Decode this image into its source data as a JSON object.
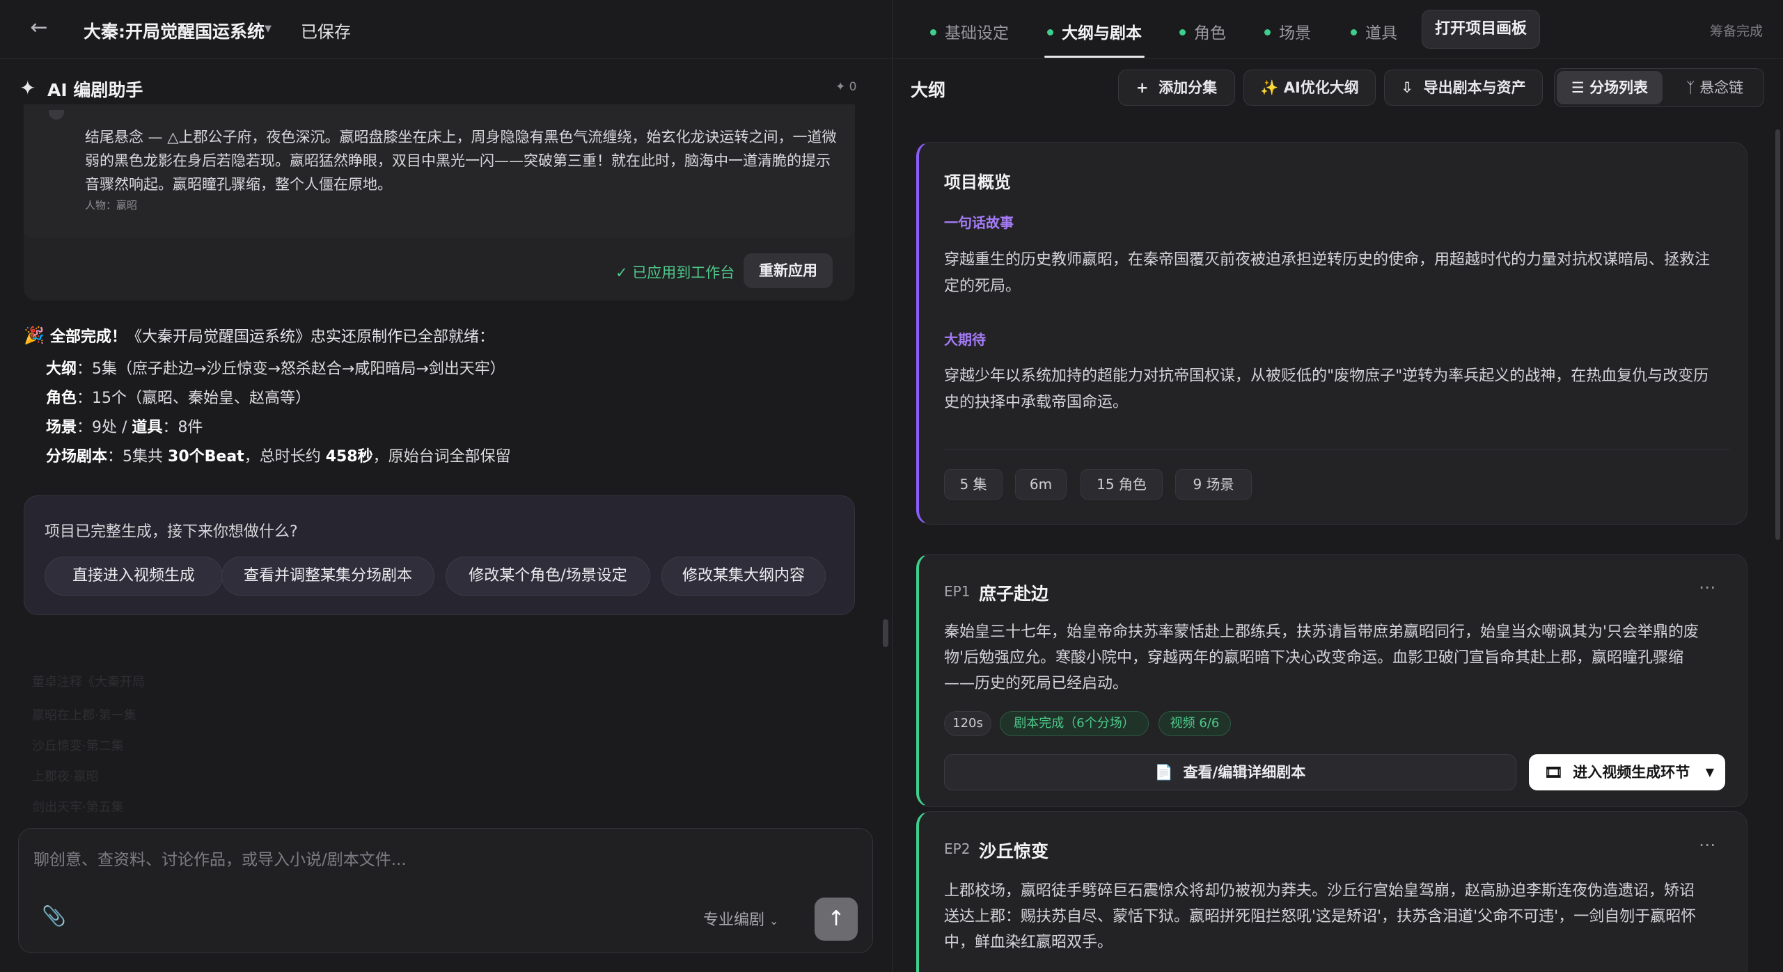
{
  "header": {
    "back_icon": "arrow-left-icon",
    "project_title": "大秦:开局觉醒国运系统",
    "save_status": "已保存"
  },
  "assistant": {
    "title": "AI 编剧助手",
    "count": "✦ 0",
    "prev_card": {
      "text": "结尾悬念 — △上郡公子府，夜色深沉。嬴昭盘膝坐在床上，周身隐隐有黑色气流缠绕，始玄化龙诀运转之间，一道微弱的黑色龙影在身后若隐若现。嬴昭猛然睁眼，双目中黑光一闪——突破第三重！就在此时，脑海中一道清脆的提示音骤然响起。嬴昭瞳孔骤缩，整个人僵在原地。",
      "people": "人物：嬴昭",
      "applied": "✓ 已应用到工作台",
      "reapply": "重新应用"
    },
    "done": {
      "icon": "🎉",
      "bold": "全部完成！",
      "rest": "《大秦开局觉醒国运系统》忠实还原制作已全部就绪：",
      "outline_label": "大纲",
      "outline_value": "：5集（庶子赴边→沙丘惊变→怒杀赵合→咸阳暗局→剑出天牢）",
      "roles_label": "角色",
      "roles_value": "：15个（嬴昭、秦始皇、赵高等）",
      "scenes_label": "场景",
      "scenes_value": "：9处 / ",
      "props_label": "道具",
      "props_value": "：8件",
      "script_label": "分场剧本",
      "script_a": "：5集共 ",
      "script_beats": "30个Beat",
      "script_b": "，总时长约 ",
      "script_secs": "458秒",
      "script_c": "，原始台词全部保留"
    },
    "next": {
      "question": "项目已完整生成，接下来你想做什么?",
      "options": [
        "直接进入视频生成",
        "查看并调整某集分场剧本",
        "修改某个角色/场景设定",
        "修改某集大纲内容"
      ]
    },
    "faded": [
      "董卓注释《大秦开局",
      "嬴昭在上郡·第一集",
      "沙丘惊变·第二集",
      "上郡夜·嬴昭",
      "剑出天牢·第五集"
    ],
    "composer": {
      "placeholder": "聊创意、查资料、讨论作品，或导入小说/剧本文件...",
      "mode": "专业编剧"
    }
  },
  "tabs": [
    {
      "label": "基础设定"
    },
    {
      "label": "大纲与剧本"
    },
    {
      "label": "角色"
    },
    {
      "label": "场景"
    },
    {
      "label": "道具"
    }
  ],
  "top_right": {
    "open_canvas": "打开项目画板",
    "prep_done": "筹备完成"
  },
  "outline": {
    "title": "大纲",
    "add_episode": "添加分集",
    "ai_optimize": "AI优化大纲",
    "export": "导出剧本与资产",
    "scene_list": "分场列表",
    "suspense_chain": "悬念链"
  },
  "overview": {
    "title": "项目概览",
    "logline_label": "一句话故事",
    "logline": "穿越重生的历史教师嬴昭，在秦帝国覆灭前夜被迫承担逆转历史的使命，用超越时代的力量对抗权谋暗局、拯救注定的死局。",
    "expect_label": "大期待",
    "expect": "穿越少年以系统加持的超能力对抗帝国权谋，从被贬低的\"废物庶子\"逆转为率兵起义的战神，在热血复仇与改变历史的抉择中承载帝国命运。",
    "chips": [
      "5 集",
      "6m",
      "15 角色",
      "9 场景"
    ]
  },
  "episodes": [
    {
      "no": "EP1",
      "name": "庶子赴边",
      "text": "秦始皇三十七年，始皇帝命扶苏率蒙恬赴上郡练兵，扶苏请旨带庶弟嬴昭同行，始皇当众嘲讽其为'只会举鼎的废物'后勉强应允。寒酸小院中，穿越两年的嬴昭暗下决心改变命运。血影卫破门宣旨命其赴上郡，嬴昭瞳孔骤缩——历史的死局已经启动。",
      "duration": "120s",
      "script_status": "剧本完成（6个分场）",
      "video_status": "视频 6/6",
      "edit_label": "查看/编辑详细剧本",
      "video_label": "进入视频生成环节"
    },
    {
      "no": "EP2",
      "name": "沙丘惊变",
      "text": "上郡校场，嬴昭徒手劈碎巨石震惊众将却仍被视为莽夫。沙丘行宫始皇驾崩，赵高胁迫李斯连夜伪造遗诏，矫诏送达上郡：赐扶苏自尽、蒙恬下狱。嬴昭拼死阻拦怒吼'这是矫诏'，扶苏含泪道'父命不可违'，一剑自刎于嬴昭怀中，鲜血染红嬴昭双手。"
    }
  ]
}
